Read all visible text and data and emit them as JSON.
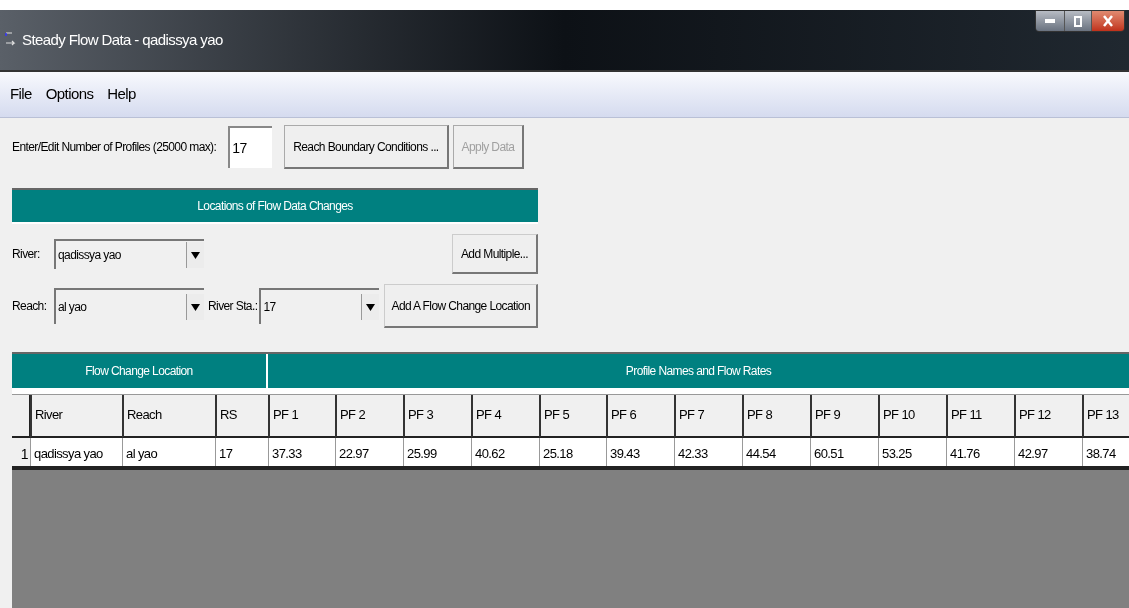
{
  "window": {
    "title": "Steady Flow Data - qadissya yao"
  },
  "menu": [
    "File",
    "Options",
    "Help"
  ],
  "profiles": {
    "label": "Enter/Edit Number of Profiles (25000 max):",
    "value": "17"
  },
  "buttons": [
    {
      "label": "Reach Boundary Conditions ...",
      "disabled": false
    },
    {
      "label": "Apply Data",
      "disabled": true
    }
  ],
  "locations": {
    "title": "Locations of Flow Data Changes",
    "river_label": "River:",
    "river": "qadissya yao",
    "add_multiple": "Add Multiple...",
    "reach_label": "Reach:",
    "reach": "al yao",
    "station_label": "River Sta.:",
    "station": "17",
    "add_location": "Add A Flow Change Location"
  },
  "table": {
    "group_headers": [
      "Flow Change Location",
      "Profile Names and Flow Rates"
    ],
    "columns": [
      "River",
      "Reach",
      "RS",
      "PF 1",
      "PF 2",
      "PF 3",
      "PF 4",
      "PF 5",
      "PF 6",
      "PF 7",
      "PF 8",
      "PF 9",
      "PF 10",
      "PF 11",
      "PF 12",
      "PF 13"
    ],
    "rows": [
      {
        "number": "1",
        "cells": [
          "qadissya yao",
          "al yao",
          "17",
          "37.33",
          "22.97",
          "25.99",
          "40.62",
          "25.18",
          "39.43",
          "42.33",
          "44.54",
          "60.51",
          "53.25",
          "41.76",
          "42.97",
          "38.74"
        ]
      }
    ]
  }
}
